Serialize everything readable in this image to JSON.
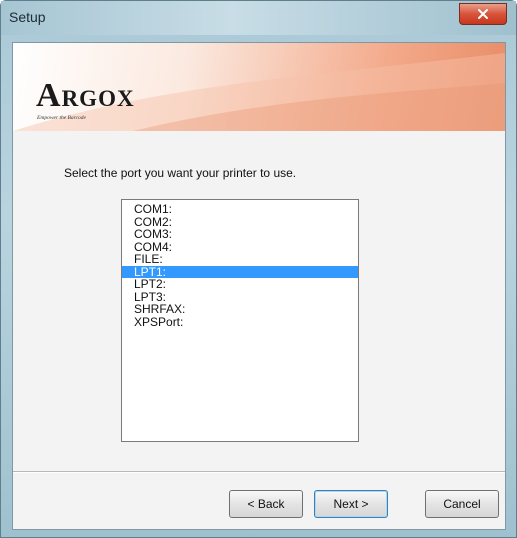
{
  "window": {
    "title": "Setup",
    "close_icon": "close-icon"
  },
  "banner": {
    "logo_first": "A",
    "logo_rest": "RGOX",
    "tagline": "Empower the Barcode"
  },
  "main": {
    "prompt": "Select the port you want your printer to use.",
    "ports": [
      "COM1:",
      "COM2:",
      "COM3:",
      "COM4:",
      "FILE:",
      "LPT1:",
      "LPT2:",
      "LPT3:",
      "SHRFAX:",
      "XPSPort:"
    ],
    "selected_port": "LPT1:"
  },
  "buttons": {
    "back": "< Back",
    "next": "Next >",
    "cancel": "Cancel"
  },
  "colors": {
    "selection": "#3399ff",
    "close_button": "#d8533a",
    "banner_accent": "#e88c66"
  }
}
